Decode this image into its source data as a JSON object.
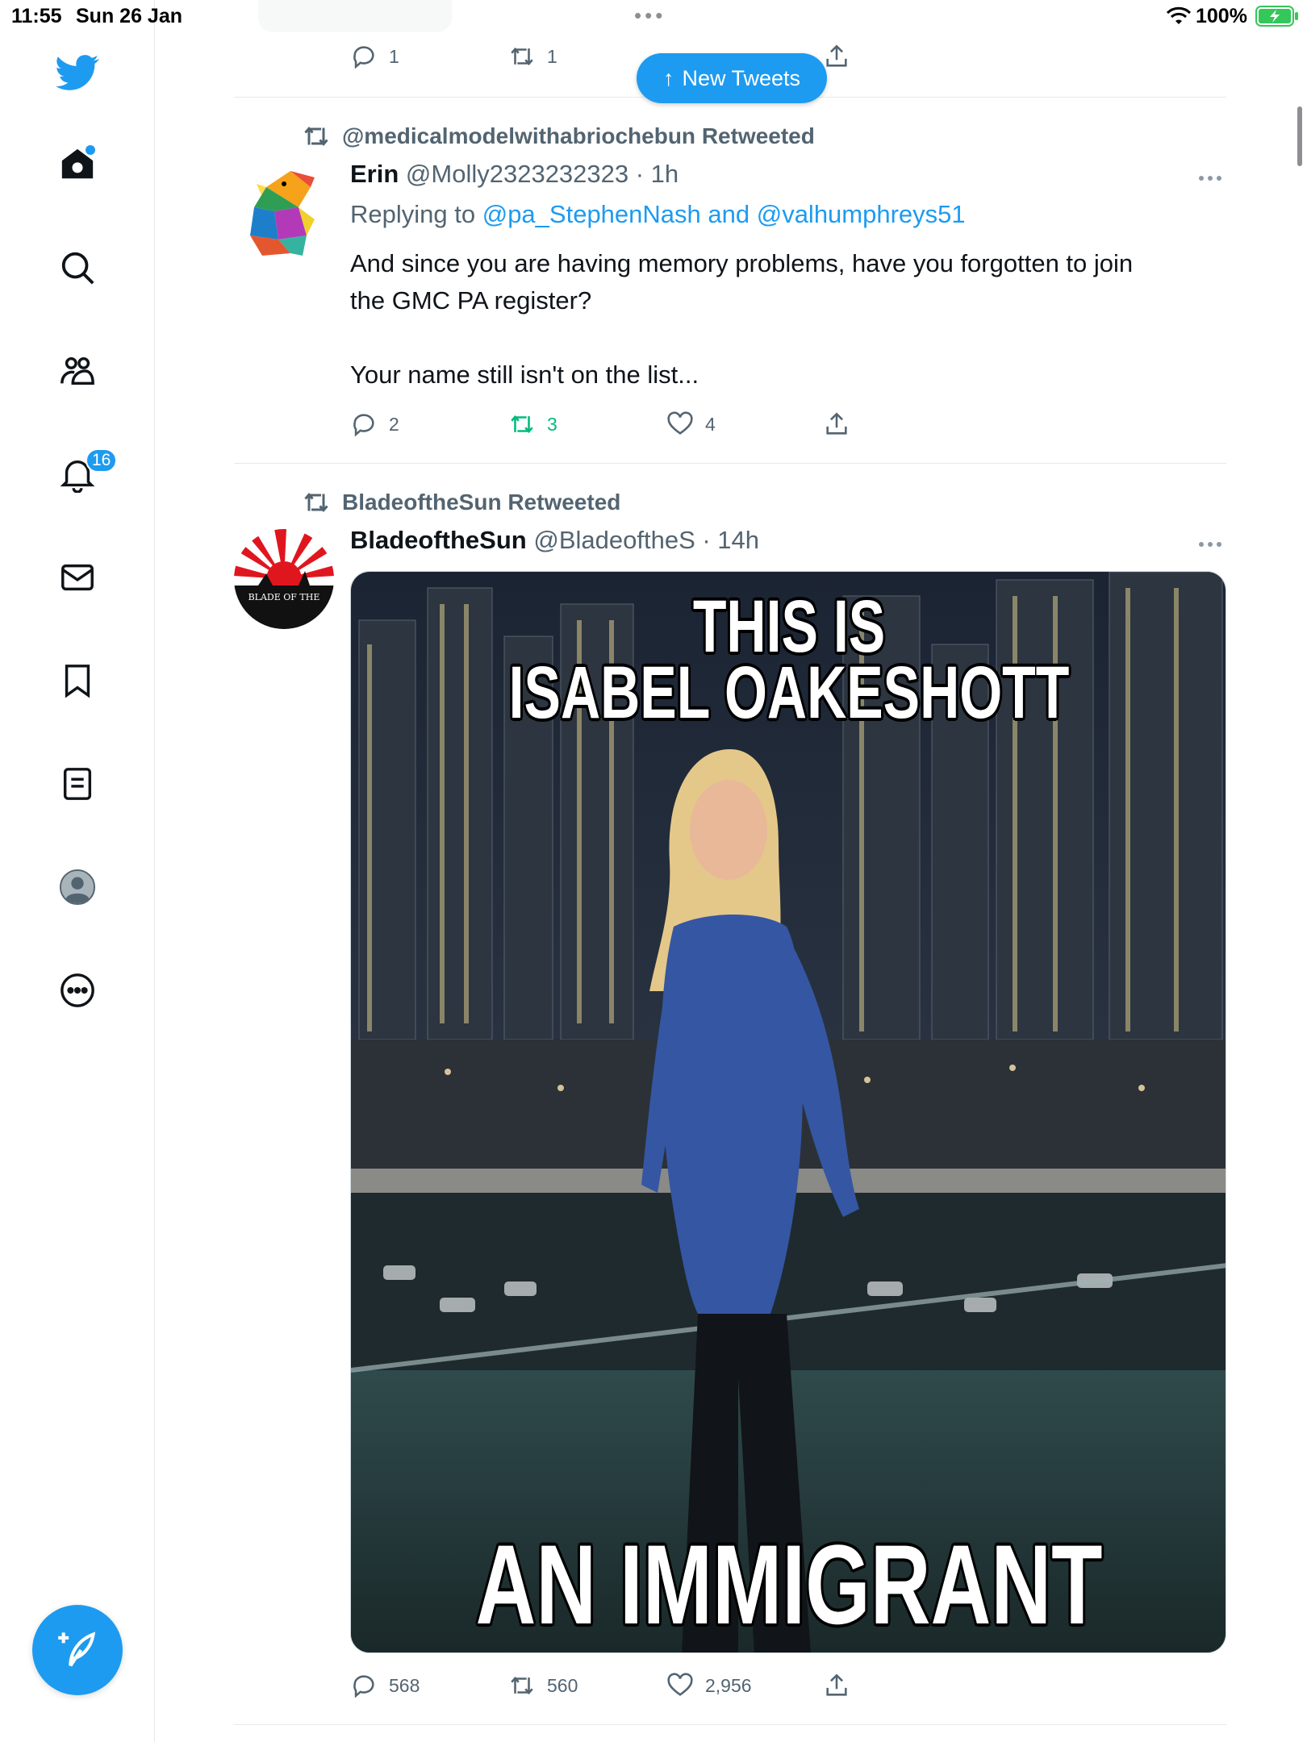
{
  "status_bar": {
    "time": "11:55",
    "date": "Sun 26 Jan",
    "battery_pct": "100%"
  },
  "sidebar": {
    "items": [
      {
        "icon": "twitter-bird-icon"
      },
      {
        "icon": "home-icon",
        "has_dot": true
      },
      {
        "icon": "search-icon"
      },
      {
        "icon": "communities-icon"
      },
      {
        "icon": "notifications-icon",
        "badge": "16"
      },
      {
        "icon": "messages-icon"
      },
      {
        "icon": "bookmarks-icon"
      },
      {
        "icon": "lists-icon"
      },
      {
        "icon": "profile-avatar-icon"
      },
      {
        "icon": "more-icon"
      }
    ],
    "compose_icon": "compose-tweet-icon"
  },
  "colors": {
    "accent": "#1d9bf0",
    "retweet_active": "#00ba7c",
    "muted": "#536471"
  },
  "new_tweets_pill": {
    "label": "New Tweets"
  },
  "previous_tweet": {
    "replies": "1",
    "retweets": "1"
  },
  "tweets": [
    {
      "retweeted_by": "@medicalmodelwithabriochebun Retweeted",
      "name": "Erin",
      "handle_time": "@Molly2323232323 · 1h",
      "replying_prefix": "Replying to",
      "replying_to": "@pa_StephenNash and @valhumphreys51",
      "text_line1": "And since you are having memory problems, have you forgotten to join",
      "text_line2": "the GMC PA register?",
      "text_line3": "Your name still isn't on the list...",
      "replies": "2",
      "retweets": "3",
      "likes": "4"
    },
    {
      "retweeted_by": "BladeoftheSun Retweeted",
      "name": "BladeoftheSun",
      "handle_time": "@BladeoftheS · 14h",
      "avatar_text": "BLADE OF THE",
      "image_caption_top_1": "THIS IS",
      "image_caption_top_2": "ISABEL OAKESHOTT",
      "image_caption_bottom": "AN IMMIGRANT",
      "replies": "568",
      "retweets": "560",
      "likes": "2,956"
    }
  ]
}
